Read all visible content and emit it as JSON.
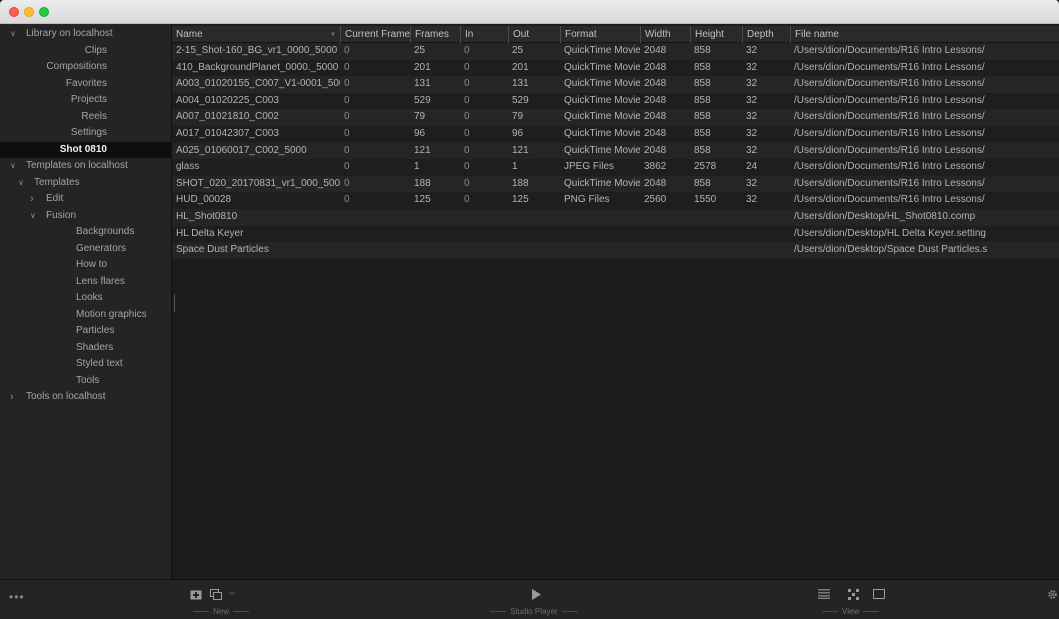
{
  "sidebar": {
    "items": [
      {
        "label": "Library on localhost",
        "level": 0,
        "expander": "v",
        "selected": false
      },
      {
        "label": "Clips",
        "level": 2,
        "expander": "",
        "selected": false
      },
      {
        "label": "Compositions",
        "level": 2,
        "expander": "",
        "selected": false
      },
      {
        "label": "Favorites",
        "level": 2,
        "expander": "",
        "selected": false
      },
      {
        "label": "Projects",
        "level": 2,
        "expander": "",
        "selected": false
      },
      {
        "label": "Reels",
        "level": 2,
        "expander": "",
        "selected": false
      },
      {
        "label": "Settings",
        "level": 2,
        "expander": "",
        "selected": false
      },
      {
        "label": "Shot 0810",
        "level": 2,
        "expander": "",
        "selected": true
      },
      {
        "label": "Templates on localhost",
        "level": 0,
        "expander": "v",
        "selected": false
      },
      {
        "label": "Templates",
        "level": 1,
        "expander": "v",
        "selected": false
      },
      {
        "label": "Edit",
        "level": 2,
        "expander": ">",
        "selected": false
      },
      {
        "label": "Fusion",
        "level": 2,
        "expander": "v",
        "selected": false
      },
      {
        "label": "Backgrounds",
        "level": 3,
        "expander": "",
        "selected": false
      },
      {
        "label": "Generators",
        "level": 3,
        "expander": "",
        "selected": false
      },
      {
        "label": "How to",
        "level": 3,
        "expander": "",
        "selected": false
      },
      {
        "label": "Lens flares",
        "level": 3,
        "expander": "",
        "selected": false
      },
      {
        "label": "Looks",
        "level": 3,
        "expander": "",
        "selected": false
      },
      {
        "label": "Motion graphics",
        "level": 3,
        "expander": "",
        "selected": false
      },
      {
        "label": "Particles",
        "level": 3,
        "expander": "",
        "selected": false
      },
      {
        "label": "Shaders",
        "level": 3,
        "expander": "",
        "selected": false
      },
      {
        "label": "Styled text",
        "level": 3,
        "expander": "",
        "selected": false
      },
      {
        "label": "Tools",
        "level": 3,
        "expander": "",
        "selected": false
      },
      {
        "label": "Tools on localhost",
        "level": 0,
        "expander": ">",
        "selected": false
      }
    ]
  },
  "table": {
    "columns": [
      "Name",
      "Current Frame",
      "Frames",
      "In",
      "Out",
      "Format",
      "Width",
      "Height",
      "Depth",
      "File name"
    ],
    "rows": [
      [
        "2-15_Shot-160_BG_vr1_0000_5000",
        "0",
        "25",
        "0",
        "25",
        "QuickTime Movie",
        "2048",
        "858",
        "32",
        "/Users/dion/Documents/R16 Intro Lessons/"
      ],
      [
        "410_BackgroundPlanet_0000._5000",
        "0",
        "201",
        "0",
        "201",
        "QuickTime Movie",
        "2048",
        "858",
        "32",
        "/Users/dion/Documents/R16 Intro Lessons/"
      ],
      [
        "A003_01020155_C007_V1-0001_5000",
        "0",
        "131",
        "0",
        "131",
        "QuickTime Movie",
        "2048",
        "858",
        "32",
        "/Users/dion/Documents/R16 Intro Lessons/"
      ],
      [
        "A004_01020225_C003",
        "0",
        "529",
        "0",
        "529",
        "QuickTime Movie",
        "2048",
        "858",
        "32",
        "/Users/dion/Documents/R16 Intro Lessons/"
      ],
      [
        "A007_01021810_C002",
        "0",
        "79",
        "0",
        "79",
        "QuickTime Movie",
        "2048",
        "858",
        "32",
        "/Users/dion/Documents/R16 Intro Lessons/"
      ],
      [
        "A017_01042307_C003",
        "0",
        "96",
        "0",
        "96",
        "QuickTime Movie",
        "2048",
        "858",
        "32",
        "/Users/dion/Documents/R16 Intro Lessons/"
      ],
      [
        "A025_01060017_C002_5000",
        "0",
        "121",
        "0",
        "121",
        "QuickTime Movie",
        "2048",
        "858",
        "32",
        "/Users/dion/Documents/R16 Intro Lessons/"
      ],
      [
        "glass",
        "0",
        "1",
        "0",
        "1",
        "JPEG Files",
        "3862",
        "2578",
        "24",
        "/Users/dion/Documents/R16 Intro Lessons/"
      ],
      [
        "SHOT_020_20170831_vr1_000_5000",
        "0",
        "188",
        "0",
        "188",
        "QuickTime Movie",
        "2048",
        "858",
        "32",
        "/Users/dion/Documents/R16 Intro Lessons/"
      ],
      [
        "HUD_00028",
        "0",
        "125",
        "0",
        "125",
        "PNG Files",
        "2560",
        "1550",
        "32",
        "/Users/dion/Documents/R16 Intro Lessons/"
      ],
      [
        "HL_Shot0810",
        "",
        "",
        "",
        "",
        "",
        "",
        "",
        "",
        "/Users/dion/Desktop/HL_Shot0810.comp"
      ],
      [
        "HL Delta Keyer",
        "",
        "",
        "",
        "",
        "",
        "",
        "",
        "",
        "/Users/dion/Desktop/HL Delta Keyer.setting"
      ],
      [
        "Space Dust Particles",
        "",
        "",
        "",
        "",
        "",
        "",
        "",
        "",
        "/Users/dion/Desktop/Space Dust Particles.s"
      ]
    ]
  },
  "bottombar": {
    "more_glyph": "•••",
    "new_label": "New",
    "studio_player_label": "Studio Player",
    "view_label": "View",
    "icons": {
      "add_bin": "add-bin-icon",
      "duplicate": "duplicate-icon",
      "more": "more-icon",
      "play": "play-icon",
      "list_view": "list-view-icon",
      "thumb_view": "thumbnail-view-icon",
      "single_view": "single-view-icon",
      "settings": "gear-icon"
    }
  },
  "colors": {
    "selected_row_bg": "#0e0e0e",
    "table_row_alt": "#252525",
    "background": "#1c1c1c"
  }
}
